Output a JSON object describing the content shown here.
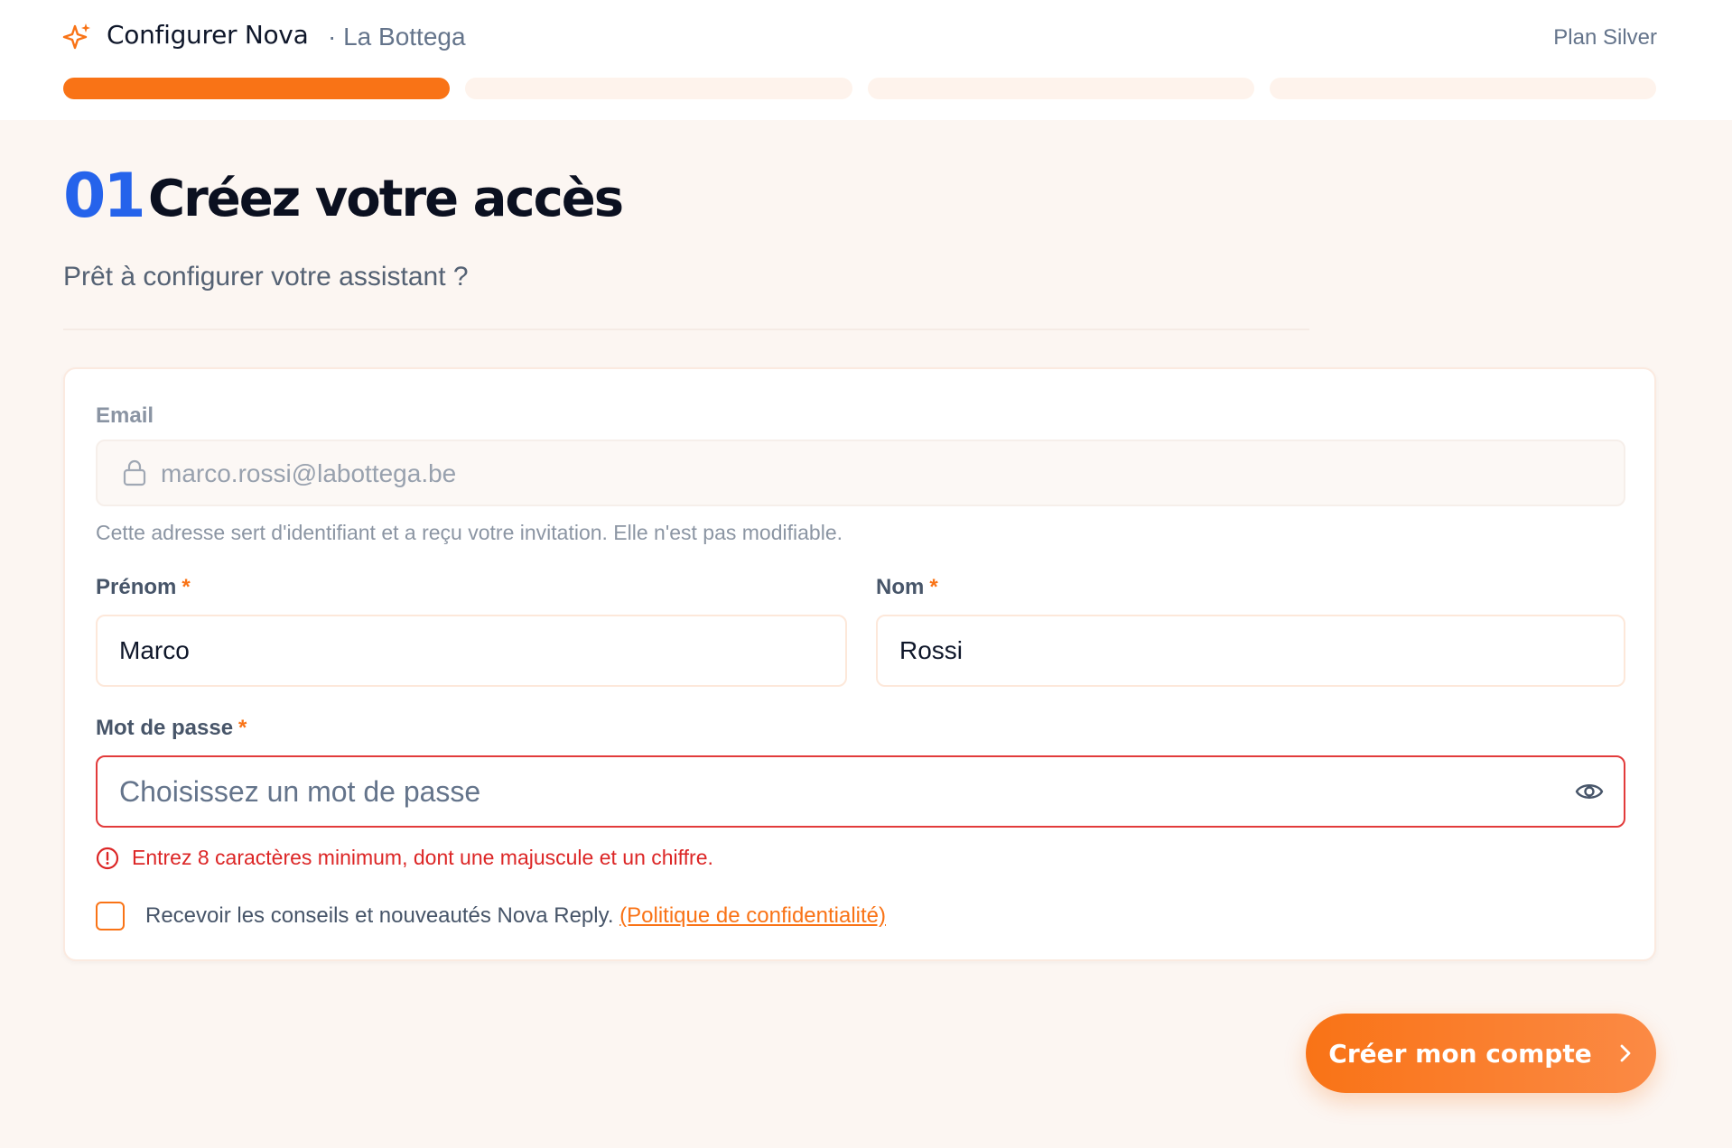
{
  "header": {
    "app_title": "Configurer Nova",
    "organization": "· La Bottega",
    "plan": "Plan Silver",
    "progress_steps": 4,
    "progress_current": 1
  },
  "step": {
    "number": "01",
    "title": "Créez votre accès",
    "subtitle": "Prêt à configurer votre assistant ?"
  },
  "form": {
    "email": {
      "label": "Email",
      "value": "marco.rossi@labottega.be",
      "helper": "Cette adresse sert d'identifiant et a reçu votre invitation. Elle n'est pas modifiable."
    },
    "first_name": {
      "label": "Prénom",
      "required_mark": "*",
      "value": "Marco"
    },
    "last_name": {
      "label": "Nom",
      "required_mark": "*",
      "value": "Rossi"
    },
    "password": {
      "label": "Mot de passe",
      "required_mark": "*",
      "value": "",
      "placeholder": "Choisissez un mot de passe",
      "error": "Entrez 8 caractères minimum, dont une majuscule et un chiffre."
    },
    "newsletter": {
      "checked": false,
      "text": "Recevoir les conseils et nouveautés Nova Reply.",
      "link": "(Politique de confidentialité)"
    }
  },
  "submit_label": "Créer mon compte",
  "icons": {
    "brand": "sparkle-icon",
    "email": "lock-icon",
    "password_toggle": "eye-icon",
    "error": "alert-circle-icon",
    "submit": "chevron-right-icon"
  },
  "colors": {
    "accent": "#f97316",
    "step_number": "#2563eb",
    "error": "#dc2626",
    "background": "#fcf6f2"
  }
}
